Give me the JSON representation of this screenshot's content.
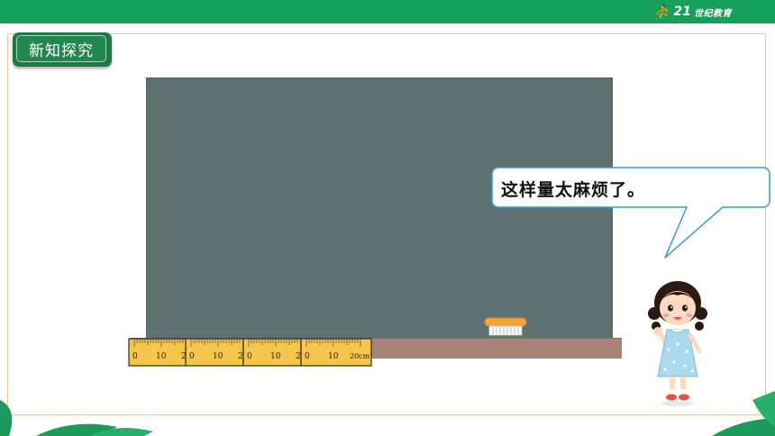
{
  "header": {
    "brand_mark": "21",
    "brand_name": "世纪教育",
    "brand_color": "#17a05a"
  },
  "section": {
    "title": "新知探究",
    "color": "#1f7a47"
  },
  "speech_bubble": {
    "text": "这样量太麻烦了。",
    "border_color": "#3a9ad9"
  },
  "blackboard": {
    "color": "#5f7070",
    "tray_color": "#a98378"
  },
  "rulers": [
    {
      "tick_labels": [
        "0",
        "10",
        "2"
      ]
    },
    {
      "tick_labels": [
        "0",
        "10",
        "2"
      ]
    },
    {
      "tick_labels": [
        "0",
        "10",
        "2"
      ]
    },
    {
      "tick_labels": [
        "0",
        "10",
        "20cm"
      ]
    }
  ],
  "icons": {
    "brand": "runner-icon",
    "eraser": "eraser-icon",
    "character": "girl-character-icon"
  }
}
